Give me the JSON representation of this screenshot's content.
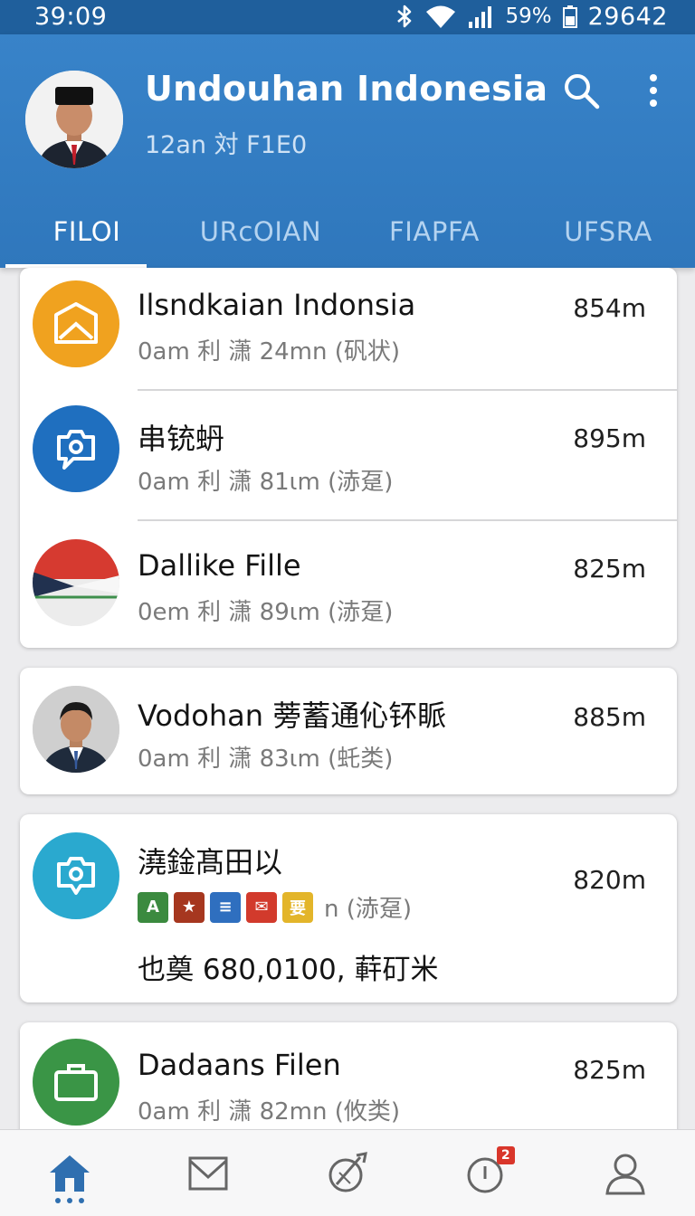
{
  "status": {
    "time": "39:09",
    "battery_pct": "59%",
    "right_number": "29642"
  },
  "header": {
    "title": "Undouhan Indonesia",
    "subtitle": "12an 対 F1E0"
  },
  "tabs": [
    {
      "label": "FILOI",
      "active": true
    },
    {
      "label": "URcOIAN",
      "active": false
    },
    {
      "label": "FIAPFA",
      "active": false
    },
    {
      "label": "UFSRA",
      "active": false
    }
  ],
  "items": [
    {
      "title": "Ilsndkaian Indonsia",
      "meta": "0am 利 潇 24mn (矾状)",
      "size": "854m",
      "icon": "image-icon",
      "color": "#f0a21f"
    },
    {
      "title": "串铳蚒",
      "meta": "0am 利 潇 81ιm (浾趸)",
      "size": "895m",
      "icon": "chat-camera-icon",
      "color": "#1f6fbf"
    },
    {
      "title": "Dallike Fille",
      "meta": "0em 利 潇 89ιm (浾趸)",
      "size": "825m",
      "icon": "indonesia-flag-icon",
      "color": "#d63a30"
    },
    {
      "title": "Vodohan 蒡蓄通伈钚眽",
      "meta": "0am 利 潇 83ιm (虴类)",
      "size": "885m",
      "icon": "person-avatar",
      "color": "#3a3a3a"
    },
    {
      "title": "澆鍂髙田以",
      "meta": "n (浾趸)",
      "size": "820m",
      "icon": "location-chat-icon",
      "color": "#2aa9cf",
      "extra": "也奠 680,0100, 蓒矴米"
    },
    {
      "title": "Dadaans Filen",
      "meta": "0am 利 潇 82mn (攸类)",
      "size": "825m",
      "icon": "briefcase-icon",
      "color": "#3a9546"
    }
  ],
  "bottom_nav": [
    {
      "name": "home",
      "icon": "home-icon",
      "active": true
    },
    {
      "name": "mail",
      "icon": "mail-icon",
      "active": false
    },
    {
      "name": "explore",
      "icon": "compass-icon",
      "active": false
    },
    {
      "name": "alerts",
      "icon": "alert-clock-icon",
      "active": false,
      "badge": "2"
    },
    {
      "name": "profile",
      "icon": "profile-icon",
      "active": false
    }
  ],
  "colors": {
    "primary": "#3380c5",
    "status_bar": "#1f5f9c",
    "background": "#ececee",
    "accent": "#2f6fb0"
  }
}
